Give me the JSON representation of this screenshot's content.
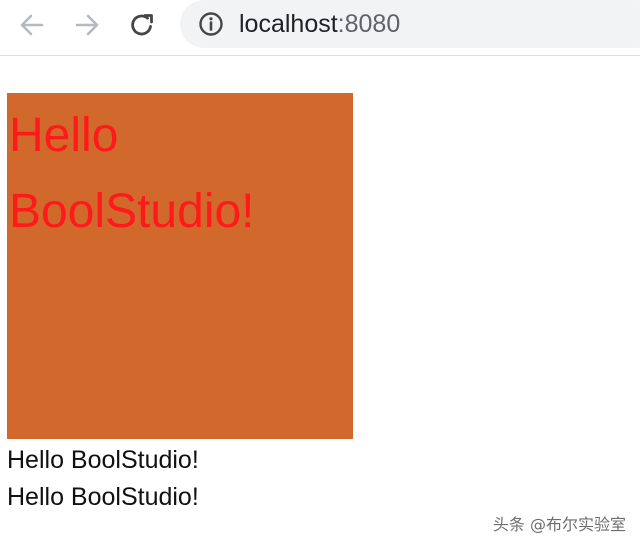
{
  "browser": {
    "url_host": "localhost",
    "url_port": ":8080",
    "icons": {
      "back": "arrow-left-icon",
      "forward": "arrow-right-icon",
      "reload": "reload-icon",
      "site_info": "info-icon"
    }
  },
  "page": {
    "box_heading": "Hello BoolStudio!",
    "line_1": "Hello BoolStudio!",
    "line_2": "Hello BoolStudio!"
  },
  "watermark": {
    "text": "头条 @布尔实验室"
  },
  "colors": {
    "box_background": "#d2692c",
    "heading_text": "#ff1a1a",
    "omnibox": "#f1f3f4"
  }
}
